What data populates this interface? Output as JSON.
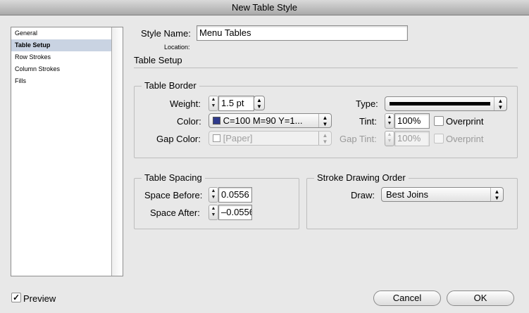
{
  "window": {
    "title": "New Table Style"
  },
  "sidebar": {
    "items": [
      {
        "label": "General",
        "selected": false
      },
      {
        "label": "Table Setup",
        "selected": true
      },
      {
        "label": "Row Strokes",
        "selected": false
      },
      {
        "label": "Column Strokes",
        "selected": false
      },
      {
        "label": "Fills",
        "selected": false
      }
    ]
  },
  "header": {
    "style_name_label": "Style Name:",
    "style_name_value": "Menu Tables",
    "location_label": "Location:",
    "section_title": "Table Setup"
  },
  "table_border": {
    "title": "Table Border",
    "weight_label": "Weight:",
    "weight_value": "1.5 pt",
    "type_label": "Type:",
    "color_label": "Color:",
    "color_value": "C=100 M=90 Y=1...",
    "color_swatch": "#2f3a8c",
    "tint_label": "Tint:",
    "tint_value": "100%",
    "overprint_label": "Overprint",
    "gap_color_label": "Gap Color:",
    "gap_color_value": "[Paper]",
    "gap_tint_label": "Gap Tint:",
    "gap_tint_value": "100%",
    "gap_overprint_label": "Overprint"
  },
  "table_spacing": {
    "title": "Table Spacing",
    "space_before_label": "Space Before:",
    "space_before_value": "0.0556",
    "space_after_label": "Space After:",
    "space_after_value": "–0.0556"
  },
  "stroke_order": {
    "title": "Stroke Drawing Order",
    "draw_label": "Draw:",
    "draw_value": "Best Joins"
  },
  "footer": {
    "preview_label": "Preview",
    "preview_checked": true,
    "cancel_label": "Cancel",
    "ok_label": "OK"
  }
}
